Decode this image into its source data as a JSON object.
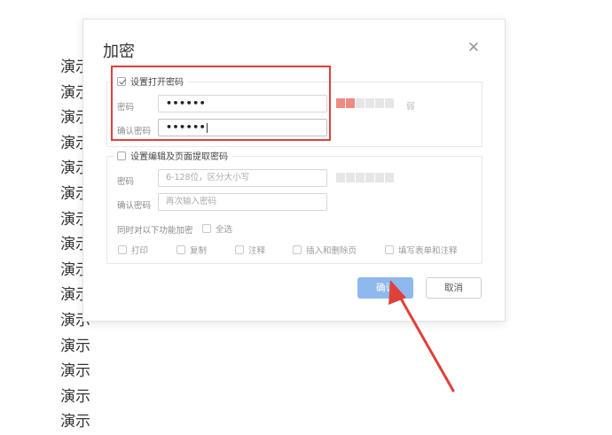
{
  "document": {
    "lines": [
      "演示",
      "演示",
      "演示",
      "演示",
      "演示",
      "演示",
      "演示",
      "演示",
      "演示",
      "演示",
      "演示",
      "演示",
      "演示",
      "演示",
      "演示"
    ]
  },
  "dialog": {
    "title": "加密",
    "close_icon": "close-icon",
    "open_password": {
      "checkbox_label": "设置打开密码",
      "checked": true,
      "password_label": "密码",
      "password_value": "••••••",
      "confirm_label": "确认密码",
      "confirm_value": "••••••",
      "strength_level": 2,
      "strength_segments": 6,
      "strength_text": "弱",
      "strength_color": "#f08a7e"
    },
    "edit_password": {
      "checkbox_label": "设置编辑及页面提取密码",
      "checked": false,
      "password_label": "密码",
      "password_placeholder": "6-128位，区分大小写",
      "confirm_label": "确认密码",
      "confirm_placeholder": "再次输入密码",
      "functions_label": "同时对以下功能加密",
      "select_all_label": "全选",
      "options": [
        "打印",
        "复制",
        "注释",
        "插入和删除页",
        "填写表单和注释"
      ]
    },
    "ok_label": "确认",
    "cancel_label": "取消",
    "ok_color": "#8fb8ee"
  },
  "annotation": {
    "highlight_color": "#e0403a",
    "arrow_color": "#e0403a"
  }
}
